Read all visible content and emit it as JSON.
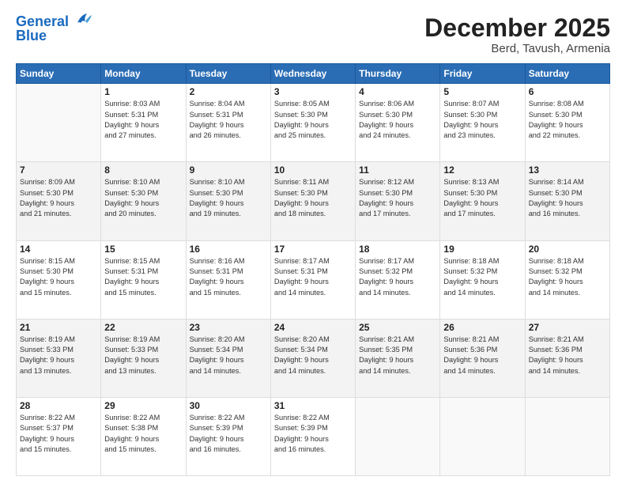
{
  "header": {
    "logo_line1": "General",
    "logo_line2": "Blue",
    "title": "December 2025",
    "subtitle": "Berd, Tavush, Armenia"
  },
  "calendar": {
    "days_of_week": [
      "Sunday",
      "Monday",
      "Tuesday",
      "Wednesday",
      "Thursday",
      "Friday",
      "Saturday"
    ],
    "weeks": [
      [
        {
          "day": "",
          "info": ""
        },
        {
          "day": "1",
          "info": "Sunrise: 8:03 AM\nSunset: 5:31 PM\nDaylight: 9 hours\nand 27 minutes."
        },
        {
          "day": "2",
          "info": "Sunrise: 8:04 AM\nSunset: 5:31 PM\nDaylight: 9 hours\nand 26 minutes."
        },
        {
          "day": "3",
          "info": "Sunrise: 8:05 AM\nSunset: 5:30 PM\nDaylight: 9 hours\nand 25 minutes."
        },
        {
          "day": "4",
          "info": "Sunrise: 8:06 AM\nSunset: 5:30 PM\nDaylight: 9 hours\nand 24 minutes."
        },
        {
          "day": "5",
          "info": "Sunrise: 8:07 AM\nSunset: 5:30 PM\nDaylight: 9 hours\nand 23 minutes."
        },
        {
          "day": "6",
          "info": "Sunrise: 8:08 AM\nSunset: 5:30 PM\nDaylight: 9 hours\nand 22 minutes."
        }
      ],
      [
        {
          "day": "7",
          "info": "Sunrise: 8:09 AM\nSunset: 5:30 PM\nDaylight: 9 hours\nand 21 minutes."
        },
        {
          "day": "8",
          "info": "Sunrise: 8:10 AM\nSunset: 5:30 PM\nDaylight: 9 hours\nand 20 minutes."
        },
        {
          "day": "9",
          "info": "Sunrise: 8:10 AM\nSunset: 5:30 PM\nDaylight: 9 hours\nand 19 minutes."
        },
        {
          "day": "10",
          "info": "Sunrise: 8:11 AM\nSunset: 5:30 PM\nDaylight: 9 hours\nand 18 minutes."
        },
        {
          "day": "11",
          "info": "Sunrise: 8:12 AM\nSunset: 5:30 PM\nDaylight: 9 hours\nand 17 minutes."
        },
        {
          "day": "12",
          "info": "Sunrise: 8:13 AM\nSunset: 5:30 PM\nDaylight: 9 hours\nand 17 minutes."
        },
        {
          "day": "13",
          "info": "Sunrise: 8:14 AM\nSunset: 5:30 PM\nDaylight: 9 hours\nand 16 minutes."
        }
      ],
      [
        {
          "day": "14",
          "info": "Sunrise: 8:15 AM\nSunset: 5:30 PM\nDaylight: 9 hours\nand 15 minutes."
        },
        {
          "day": "15",
          "info": "Sunrise: 8:15 AM\nSunset: 5:31 PM\nDaylight: 9 hours\nand 15 minutes."
        },
        {
          "day": "16",
          "info": "Sunrise: 8:16 AM\nSunset: 5:31 PM\nDaylight: 9 hours\nand 15 minutes."
        },
        {
          "day": "17",
          "info": "Sunrise: 8:17 AM\nSunset: 5:31 PM\nDaylight: 9 hours\nand 14 minutes."
        },
        {
          "day": "18",
          "info": "Sunrise: 8:17 AM\nSunset: 5:32 PM\nDaylight: 9 hours\nand 14 minutes."
        },
        {
          "day": "19",
          "info": "Sunrise: 8:18 AM\nSunset: 5:32 PM\nDaylight: 9 hours\nand 14 minutes."
        },
        {
          "day": "20",
          "info": "Sunrise: 8:18 AM\nSunset: 5:32 PM\nDaylight: 9 hours\nand 14 minutes."
        }
      ],
      [
        {
          "day": "21",
          "info": "Sunrise: 8:19 AM\nSunset: 5:33 PM\nDaylight: 9 hours\nand 13 minutes."
        },
        {
          "day": "22",
          "info": "Sunrise: 8:19 AM\nSunset: 5:33 PM\nDaylight: 9 hours\nand 13 minutes."
        },
        {
          "day": "23",
          "info": "Sunrise: 8:20 AM\nSunset: 5:34 PM\nDaylight: 9 hours\nand 14 minutes."
        },
        {
          "day": "24",
          "info": "Sunrise: 8:20 AM\nSunset: 5:34 PM\nDaylight: 9 hours\nand 14 minutes."
        },
        {
          "day": "25",
          "info": "Sunrise: 8:21 AM\nSunset: 5:35 PM\nDaylight: 9 hours\nand 14 minutes."
        },
        {
          "day": "26",
          "info": "Sunrise: 8:21 AM\nSunset: 5:36 PM\nDaylight: 9 hours\nand 14 minutes."
        },
        {
          "day": "27",
          "info": "Sunrise: 8:21 AM\nSunset: 5:36 PM\nDaylight: 9 hours\nand 14 minutes."
        }
      ],
      [
        {
          "day": "28",
          "info": "Sunrise: 8:22 AM\nSunset: 5:37 PM\nDaylight: 9 hours\nand 15 minutes."
        },
        {
          "day": "29",
          "info": "Sunrise: 8:22 AM\nSunset: 5:38 PM\nDaylight: 9 hours\nand 15 minutes."
        },
        {
          "day": "30",
          "info": "Sunrise: 8:22 AM\nSunset: 5:39 PM\nDaylight: 9 hours\nand 16 minutes."
        },
        {
          "day": "31",
          "info": "Sunrise: 8:22 AM\nSunset: 5:39 PM\nDaylight: 9 hours\nand 16 minutes."
        },
        {
          "day": "",
          "info": ""
        },
        {
          "day": "",
          "info": ""
        },
        {
          "day": "",
          "info": ""
        }
      ]
    ]
  }
}
